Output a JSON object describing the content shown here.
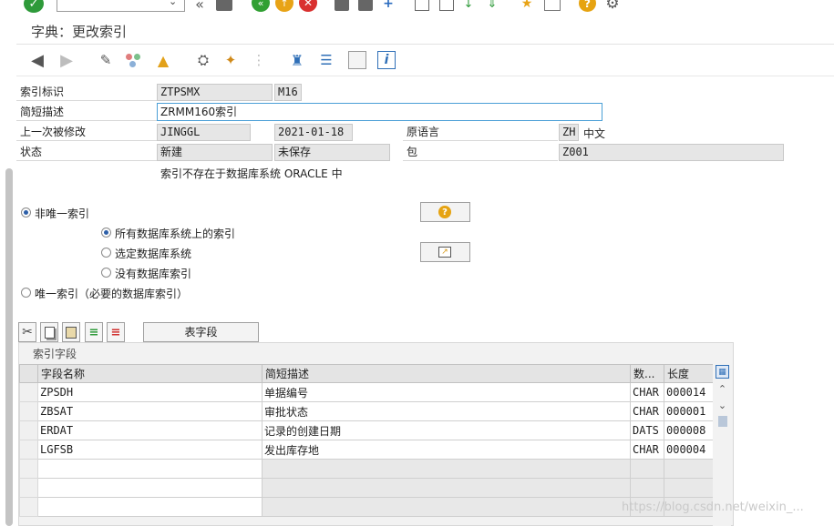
{
  "window": {
    "title": "字典：更改索引",
    "command_field": ""
  },
  "form": {
    "index_id_label": "索引标识",
    "table_value": "ZTPSMX",
    "index_value": "M16",
    "short_desc_label": "简短描述",
    "short_desc_value": "ZRMM160索引",
    "last_changed_label": "上一次被修改",
    "last_changed_user": "JINGGL",
    "last_changed_date": "2021-01-18",
    "orig_lang_label": "原语言",
    "orig_lang_code": "ZH",
    "orig_lang_name": "中文",
    "status_label": "状态",
    "status_value": "新建",
    "save_status": "未保存",
    "package_label": "包",
    "package_value": "Z001",
    "db_note": "索引不存在于数据库系统 ORACLE 中"
  },
  "index_options": {
    "non_unique_label": "非唯一索引",
    "all_db_label": "所有数据库系统上的索引",
    "selected_db_label": "选定数据库系统",
    "no_db_label": "没有数据库索引",
    "unique_label": "唯一索引（必要的数据库索引）",
    "selected": "non_unique",
    "sub_selected": "all_db"
  },
  "table_tab_label": "表字段",
  "grid": {
    "caption": "索引字段",
    "headers": [
      "字段名称",
      "简短描述",
      "数...",
      "长度"
    ],
    "rows": [
      [
        "ZPSDH",
        "单据编号",
        "CHAR",
        "000014"
      ],
      [
        "ZBSAT",
        "审批状态",
        "CHAR",
        "000001"
      ],
      [
        "ERDAT",
        "记录的创建日期",
        "DATS",
        "000008"
      ],
      [
        "LGFSB",
        "发出库存地",
        "CHAR",
        "000004"
      ],
      [
        "",
        "",
        "",
        ""
      ],
      [
        "",
        "",
        "",
        ""
      ],
      [
        "",
        "",
        "",
        ""
      ]
    ]
  },
  "watermark": "https://blog.csdn.net/weixin_..."
}
